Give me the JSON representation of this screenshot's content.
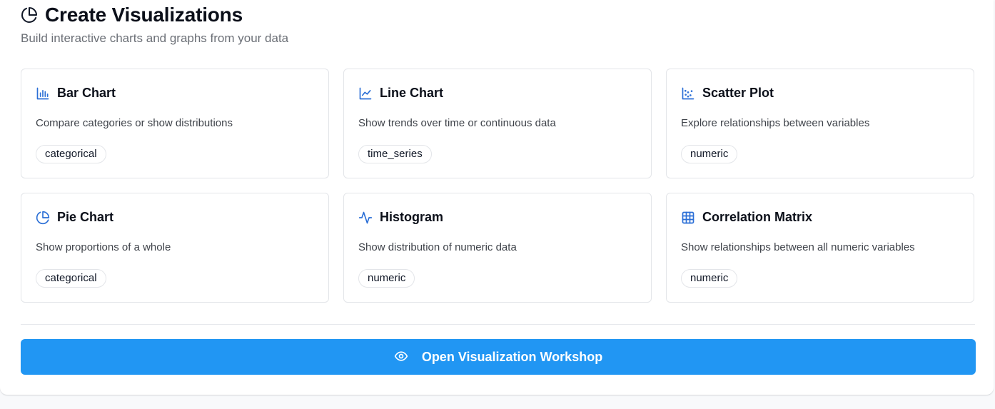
{
  "header": {
    "title": "Create Visualizations",
    "subtitle": "Build interactive charts and graphs from your data",
    "icon": "pie-chart-icon"
  },
  "cards": [
    {
      "title": "Bar Chart",
      "description": "Compare categories or show distributions",
      "tag": "categorical",
      "icon": "bar-chart-icon"
    },
    {
      "title": "Line Chart",
      "description": "Show trends over time or continuous data",
      "tag": "time_series",
      "icon": "line-chart-icon"
    },
    {
      "title": "Scatter Plot",
      "description": "Explore relationships between variables",
      "tag": "numeric",
      "icon": "scatter-plot-icon"
    },
    {
      "title": "Pie Chart",
      "description": "Show proportions of a whole",
      "tag": "categorical",
      "icon": "pie-chart-icon"
    },
    {
      "title": "Histogram",
      "description": "Show distribution of numeric data",
      "tag": "numeric",
      "icon": "activity-icon"
    },
    {
      "title": "Correlation Matrix",
      "description": "Show relationships between all numeric variables",
      "tag": "numeric",
      "icon": "grid-icon"
    }
  ],
  "action": {
    "label": "Open Visualization Workshop",
    "icon": "eye-icon"
  },
  "colors": {
    "accent": "#2196f3",
    "icon_blue": "#2b6fd6",
    "border": "#e3e5e9",
    "muted_text": "#6b6f76"
  }
}
